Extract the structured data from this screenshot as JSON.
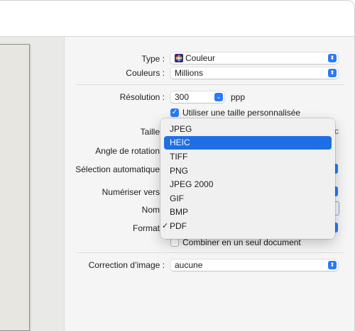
{
  "settings": {
    "type_label": "Type :",
    "type_value": "Couleur",
    "colors_label": "Couleurs :",
    "colors_value": "Millions",
    "resolution_label": "Résolution :",
    "resolution_value": "300",
    "resolution_unit": "ppp",
    "custom_size_label": "Utiliser une taille personnalisée",
    "custom_size_checked": true,
    "size_label": "Taille",
    "rotation_label": "Angle de rotation",
    "auto_select_label": "Sélection automatique",
    "scan_to_label": "Numériser vers",
    "name_label": "Nom",
    "format_label": "Format",
    "combine_label": "Combiner en un seul document",
    "combine_checked": false,
    "image_correction_label": "Correction d’image :",
    "image_correction_value": "aucune"
  },
  "format_menu": {
    "options": [
      "JPEG",
      "HEIC",
      "TIFF",
      "PNG",
      "JPEG 2000",
      "GIF",
      "BMP",
      "PDF"
    ],
    "highlighted": "HEIC",
    "selected": "PDF"
  },
  "icons": {
    "type_icon": "color-flower-icon",
    "popup_chevron": "chevron-updown-icon",
    "checkmark": "checkmark-icon"
  },
  "colors": {
    "accent": "#2a7bf6",
    "highlight": "#1f6ee5"
  }
}
